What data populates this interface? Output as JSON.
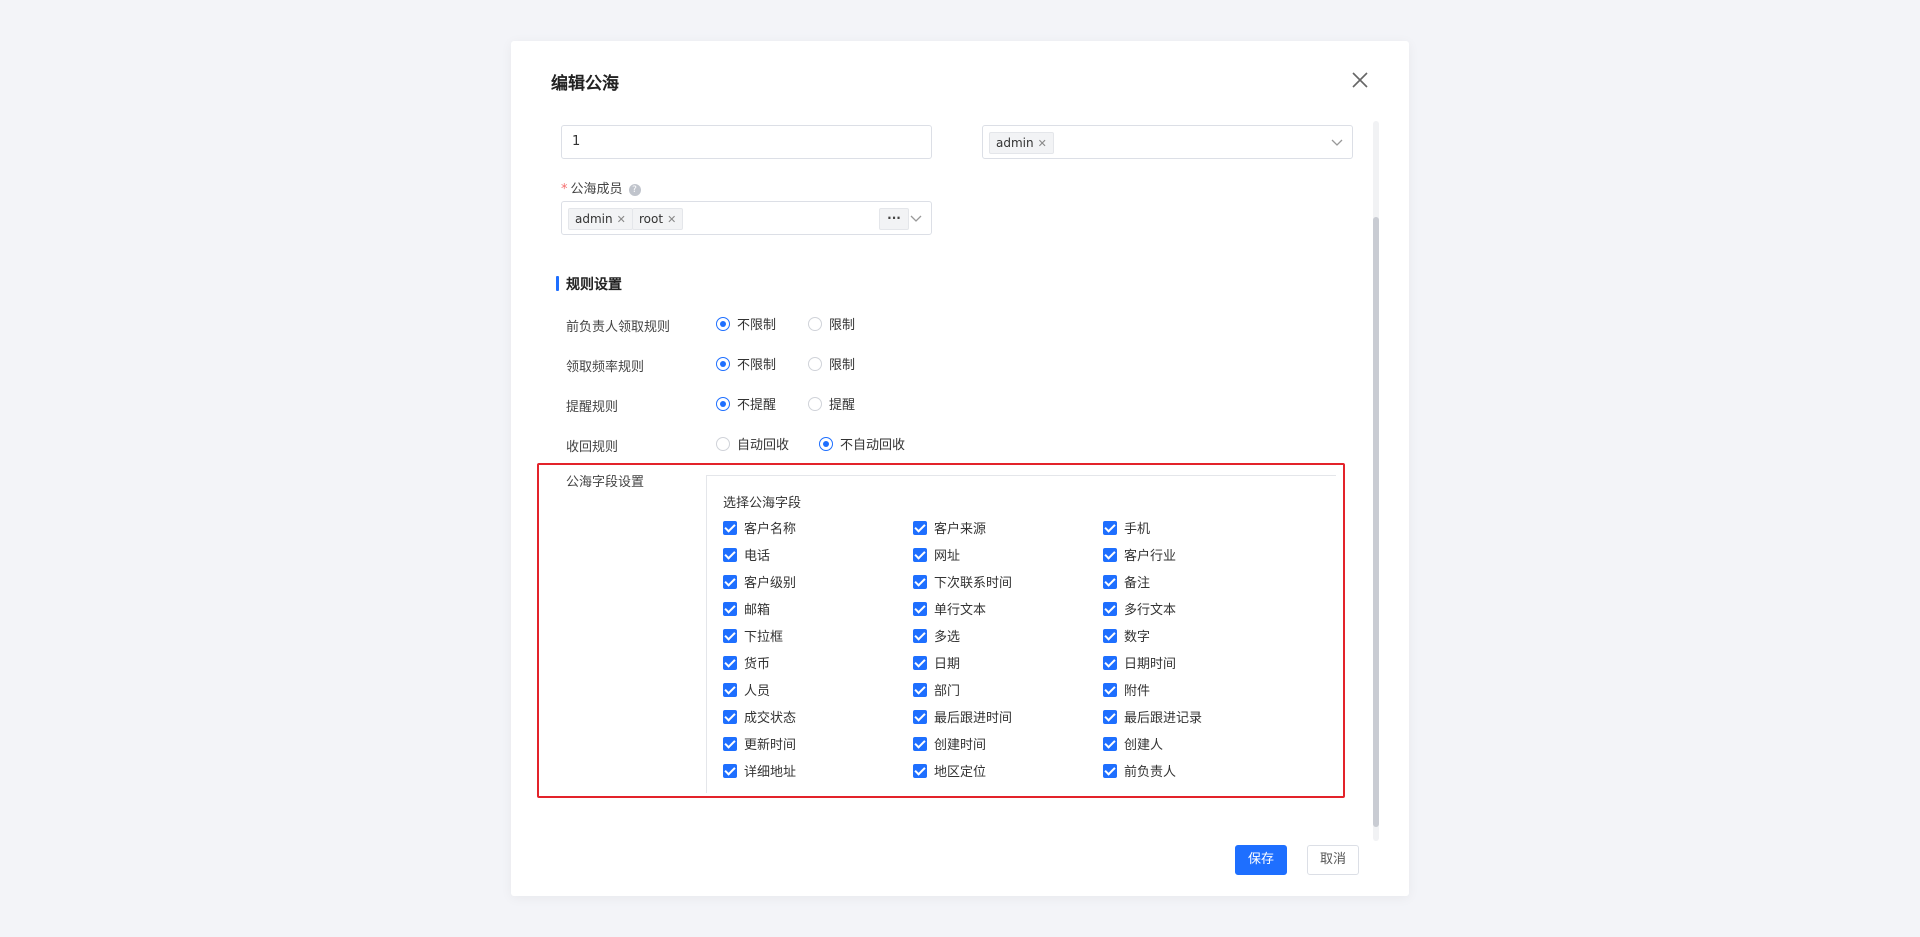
{
  "dialog": {
    "title": "编辑公海"
  },
  "form": {
    "name_value": "1",
    "owner_tags": [
      "admin"
    ],
    "members_label": "公海成员",
    "members_required_mark": "*",
    "members_tags": [
      "admin",
      "root"
    ],
    "more_label": "···"
  },
  "rules": {
    "section_title": "规则设置",
    "items": [
      {
        "label": "前负责人领取规则",
        "options": [
          "不限制",
          "限制"
        ],
        "selected": 0
      },
      {
        "label": "领取频率规则",
        "options": [
          "不限制",
          "限制"
        ],
        "selected": 0
      },
      {
        "label": "提醒规则",
        "options": [
          "不提醒",
          "提醒"
        ],
        "selected": 0
      },
      {
        "label": "收回规则",
        "options": [
          "自动回收",
          "不自动回收"
        ],
        "selected": 1
      }
    ]
  },
  "fields": {
    "label": "公海字段设置",
    "heading": "选择公海字段",
    "items": [
      "客户名称",
      "客户来源",
      "手机",
      "电话",
      "网址",
      "客户行业",
      "客户级别",
      "下次联系时间",
      "备注",
      "邮箱",
      "单行文本",
      "多行文本",
      "下拉框",
      "多选",
      "数字",
      "货币",
      "日期",
      "日期时间",
      "人员",
      "部门",
      "附件",
      "成交状态",
      "最后跟进时间",
      "最后跟进记录",
      "更新时间",
      "创建时间",
      "创建人",
      "详细地址",
      "地区定位",
      "前负责人"
    ],
    "all_checked": true
  },
  "footer": {
    "save_label": "保存",
    "cancel_label": "取消"
  },
  "icons": {
    "close": "close-icon",
    "chevron": "chevron-down-icon",
    "help": "help-icon",
    "checkbox": "checkbox-checked-icon"
  },
  "colors": {
    "primary": "#1e6fff",
    "highlight": "#e3232a",
    "required": "#f56c6c"
  }
}
